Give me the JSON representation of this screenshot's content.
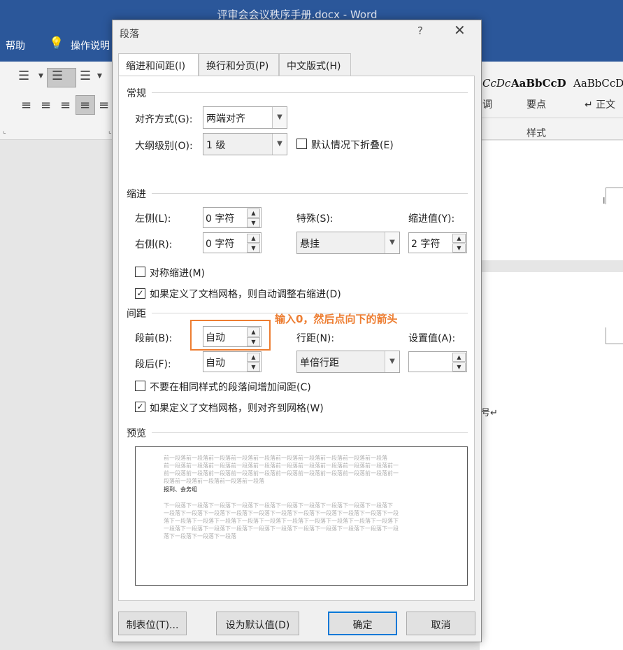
{
  "window": {
    "doc_title": "评审会会议秩序手册.docx  -  Word"
  },
  "menu": {
    "help": "帮助",
    "tell_me": "操作说明"
  },
  "ribbon": {
    "styles": [
      {
        "sample": "CcDc",
        "label": "调"
      },
      {
        "sample": "AaBbCcD",
        "label": "要点"
      },
      {
        "sample": "AaBbCcDc",
        "label": "↵ 正文"
      }
    ],
    "styles_group": "样式"
  },
  "doc": {
    "text_fragment": "号↵"
  },
  "dialog": {
    "title": "段落",
    "help": "?",
    "close": "✕",
    "tabs": [
      "缩进和间距(I)",
      "换行和分页(P)",
      "中文版式(H)"
    ],
    "general": {
      "title": "常规",
      "align_label": "对齐方式(G):",
      "align_value": "两端对齐",
      "outline_label": "大纲级别(O):",
      "outline_value": "1 级",
      "collapse_label": "默认情况下折叠(E)"
    },
    "indent": {
      "title": "缩进",
      "left_label": "左侧(L):",
      "left_value": "0 字符",
      "right_label": "右侧(R):",
      "right_value": "0 字符",
      "special_label": "特殊(S):",
      "special_value": "悬挂",
      "by_label": "缩进值(Y):",
      "by_value": "2 字符",
      "mirror_label": "对称缩进(M)",
      "auto_adjust_label": "如果定义了文档网格，则自动调整右缩进(D)"
    },
    "spacing": {
      "title": "间距",
      "before_label": "段前(B):",
      "before_value": "自动",
      "after_label": "段后(F):",
      "after_value": "自动",
      "line_label": "行距(N):",
      "line_value": "单倍行距",
      "at_label": "设置值(A):",
      "at_value": "",
      "no_space_label": "不要在相同样式的段落间增加间距(C)",
      "snap_grid_label": "如果定义了文档网格，则对齐到网格(W)"
    },
    "annotation": "输入0，然后点向下的箭头",
    "preview": {
      "title": "预览",
      "prev_lines": [
        "前一段落前一段落前一段落前一段落前一段落前一段落前一段落前一段落前一段落前一段落",
        "前一段落前一段落前一段落前一段落前一段落前一段落前一段落前一段落前一段落前一段落前一",
        "前一段落前一段落前一段落前一段落前一段落前一段落前一段落前一段落前一段落前一段落前一",
        "段落前一段落前一段落前一段落前一段落"
      ],
      "sample": "报到、会务组",
      "next_lines": [
        "下一段落下一段落下一段落下一段落下一段落下一段落下一段落下一段落下一段落下一段落下",
        "一段落下一段落下一段落下一段落下一段落下一段落下一段落下一段落下一段落下一段落下一段",
        "落下一段落下一段落下一段落下一段落下一段落下一段落下一段落下一段落下一段落下一段落下",
        "一段落下一段落下一段落下一段落下一段落下一段落下一段落下一段落下一段落下一段落下一段",
        "落下一段落下一段落下一段落"
      ]
    },
    "buttons": {
      "tabs": "制表位(T)...",
      "default": "设为默认值(D)",
      "ok": "确定",
      "cancel": "取消"
    }
  }
}
